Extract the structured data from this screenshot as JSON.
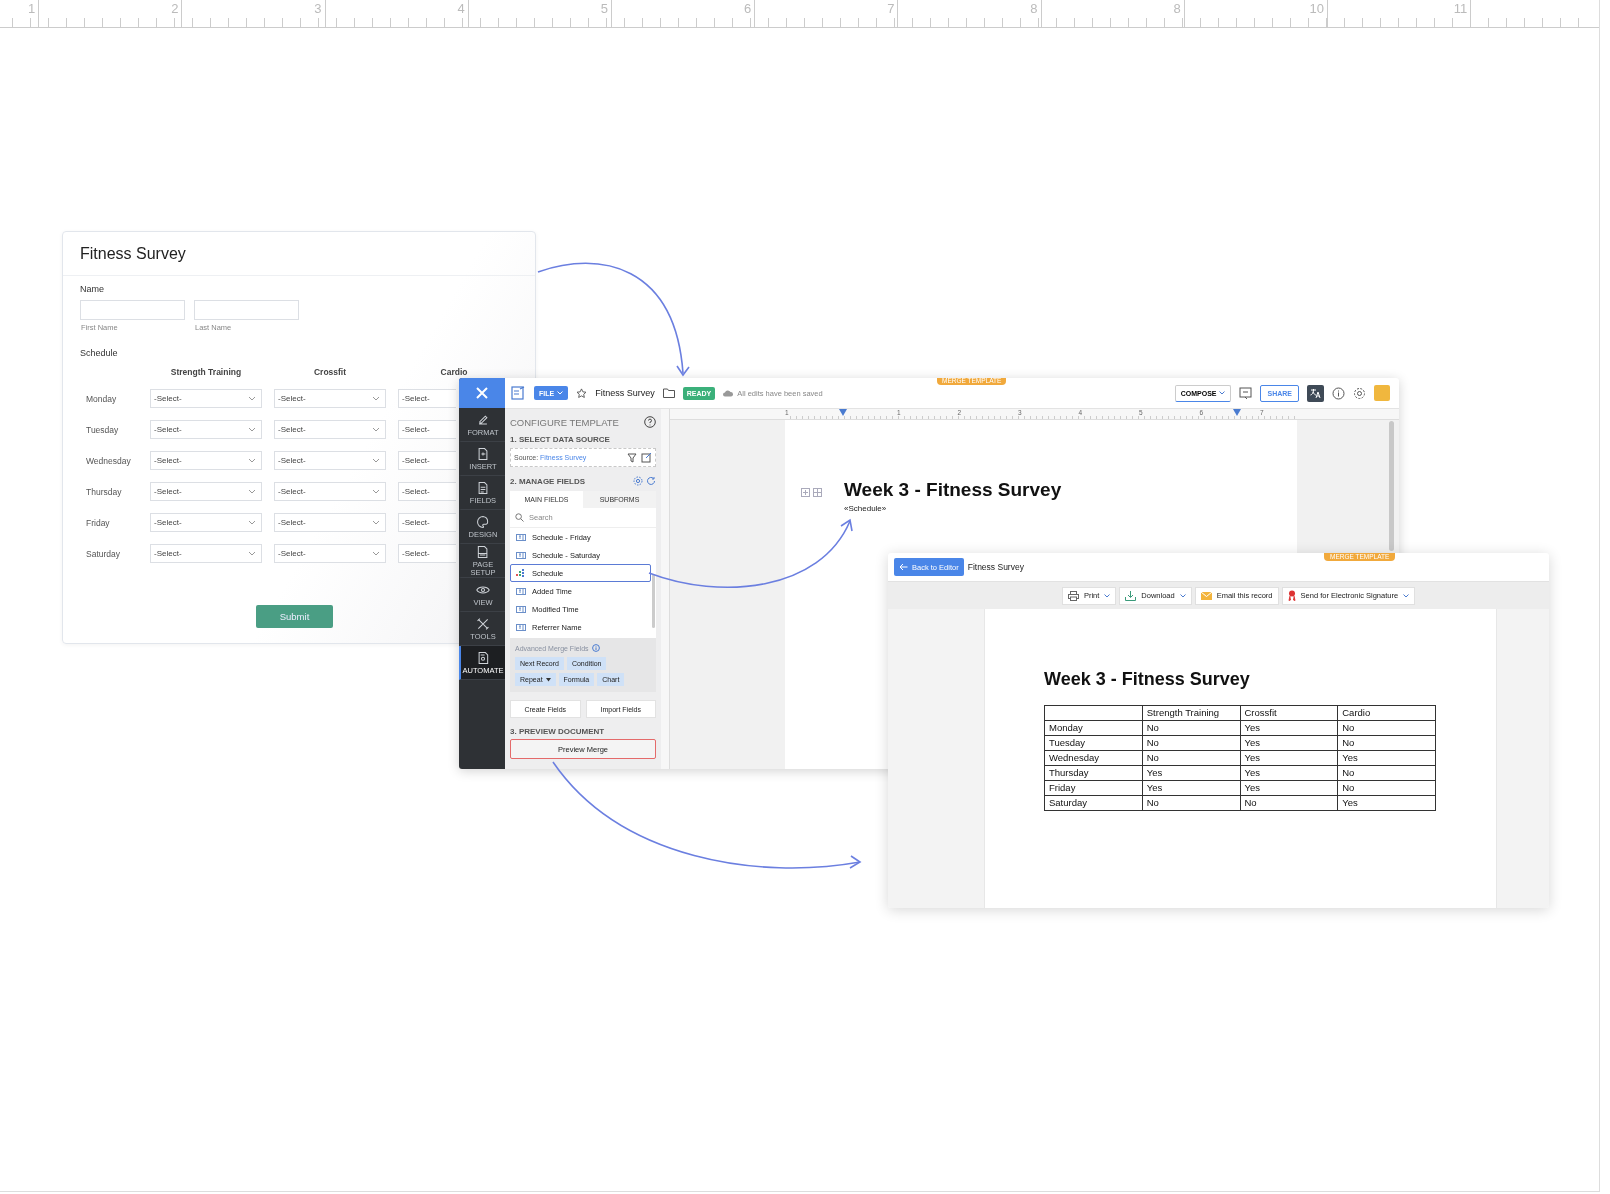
{
  "ruler": {
    "labels": [
      "1",
      "2",
      "3",
      "4",
      "5",
      "6",
      "7",
      "8",
      "8",
      "10",
      "11"
    ]
  },
  "survey_form": {
    "title": "Fitness Survey",
    "name_label": "Name",
    "first_name_caption": "First Name",
    "last_name_caption": "Last Name",
    "schedule_label": "Schedule",
    "columns": [
      "Strength Training",
      "Crossfit",
      "Cardio"
    ],
    "rows": [
      {
        "day": "Monday",
        "selects": [
          "-Select-",
          "-Select-",
          "-Select-"
        ]
      },
      {
        "day": "Tuesday",
        "selects": [
          "-Select-",
          "-Select-",
          "-Select-"
        ]
      },
      {
        "day": "Wednesday",
        "selects": [
          "-Select-",
          "-Select-",
          "-Select-"
        ]
      },
      {
        "day": "Thursday",
        "selects": [
          "-Select-",
          "-Select-",
          "-Select-"
        ]
      },
      {
        "day": "Friday",
        "selects": [
          "-Select-",
          "-Select-",
          "-Select-"
        ]
      },
      {
        "day": "Saturday",
        "selects": [
          "-Select-",
          "-Select-",
          "-Select-"
        ]
      }
    ],
    "submit": "Submit"
  },
  "editor": {
    "toolbar": {
      "file_menu": "FILE",
      "document_title": "Fitness Survey",
      "status": "READY",
      "save_status": "All edits have been saved",
      "merge_tab": "MERGE TEMPLATE",
      "compose": "COMPOSE",
      "share": "SHARE"
    },
    "sidebar": [
      {
        "label": "FORMAT",
        "kind": "format",
        "selected": false
      },
      {
        "label": "INSERT",
        "kind": "insert",
        "selected": false
      },
      {
        "label": "FIELDS",
        "kind": "fields",
        "selected": false
      },
      {
        "label": "DESIGN",
        "kind": "design",
        "selected": false
      },
      {
        "label": "PAGE SETUP",
        "kind": "page",
        "selected": false
      },
      {
        "label": "VIEW",
        "kind": "view",
        "selected": false
      },
      {
        "label": "TOOLS",
        "kind": "tools",
        "selected": false
      },
      {
        "label": "AUTOMATE",
        "kind": "automate",
        "selected": true
      }
    ],
    "panel": {
      "title": "CONFIGURE TEMPLATE",
      "step1": "1. SELECT DATA SOURCE",
      "source_label": "Source:",
      "source_value": "Fitness Survey",
      "step2": "2. MANAGE FIELDS",
      "tabs": [
        {
          "label": "MAIN FIELDS",
          "selected": true
        },
        {
          "label": "SUBFORMS",
          "selected": false
        }
      ],
      "search_placeholder": "Search",
      "fields": [
        {
          "label": "Schedule - Friday",
          "kind": "field",
          "selected": false
        },
        {
          "label": "Schedule - Saturday",
          "kind": "field",
          "selected": false
        },
        {
          "label": "Schedule",
          "kind": "subform",
          "selected": true
        },
        {
          "label": "Added Time",
          "kind": "field",
          "selected": false
        },
        {
          "label": "Modified Time",
          "kind": "field",
          "selected": false
        },
        {
          "label": "Referrer Name",
          "kind": "field",
          "selected": false
        }
      ],
      "advanced_label": "Advanced Merge Fields",
      "chips": [
        {
          "label": "Next Record",
          "kind": "plain"
        },
        {
          "label": "Condition",
          "kind": "plain"
        },
        {
          "label": "Repeat",
          "kind": "dropdown"
        },
        {
          "label": "Formula",
          "kind": "plain"
        },
        {
          "label": "Chart",
          "kind": "plain"
        }
      ],
      "buttons": [
        "Create Fields",
        "Import Fields"
      ],
      "step3": "3. PREVIEW DOCUMENT",
      "preview_button": "Preview Merge"
    },
    "ruler_labels": [
      "1",
      "1",
      "2",
      "3",
      "4",
      "5",
      "6",
      "7"
    ],
    "document": {
      "heading": "Week 3 - Fitness Survey",
      "merge_field": "«Schedule»"
    }
  },
  "preview": {
    "back_button": "Back to Editor",
    "title": "Fitness Survey",
    "merge_tab": "MERGE TEMPLATE",
    "actions": [
      {
        "label": "Print",
        "kind": "print",
        "dropdown": true
      },
      {
        "label": "Download",
        "kind": "download",
        "dropdown": true
      },
      {
        "label": "Email this record",
        "kind": "email",
        "dropdown": false
      },
      {
        "label": "Send for Electronic Signature",
        "kind": "signature",
        "dropdown": true
      }
    ],
    "heading": "Week 3 - Fitness Survey",
    "table": {
      "columns": [
        "Strength Training",
        "Crossfit",
        "Cardio"
      ],
      "rows": [
        {
          "day": "Monday",
          "cells": [
            "No",
            "Yes",
            "No"
          ]
        },
        {
          "day": "Tuesday",
          "cells": [
            "No",
            "Yes",
            "No"
          ]
        },
        {
          "day": "Wednesday",
          "cells": [
            "No",
            "Yes",
            "Yes"
          ]
        },
        {
          "day": "Thursday",
          "cells": [
            "Yes",
            "Yes",
            "No"
          ]
        },
        {
          "day": "Friday",
          "cells": [
            "Yes",
            "Yes",
            "No"
          ]
        },
        {
          "day": "Saturday",
          "cells": [
            "No",
            "No",
            "Yes"
          ]
        }
      ]
    }
  }
}
